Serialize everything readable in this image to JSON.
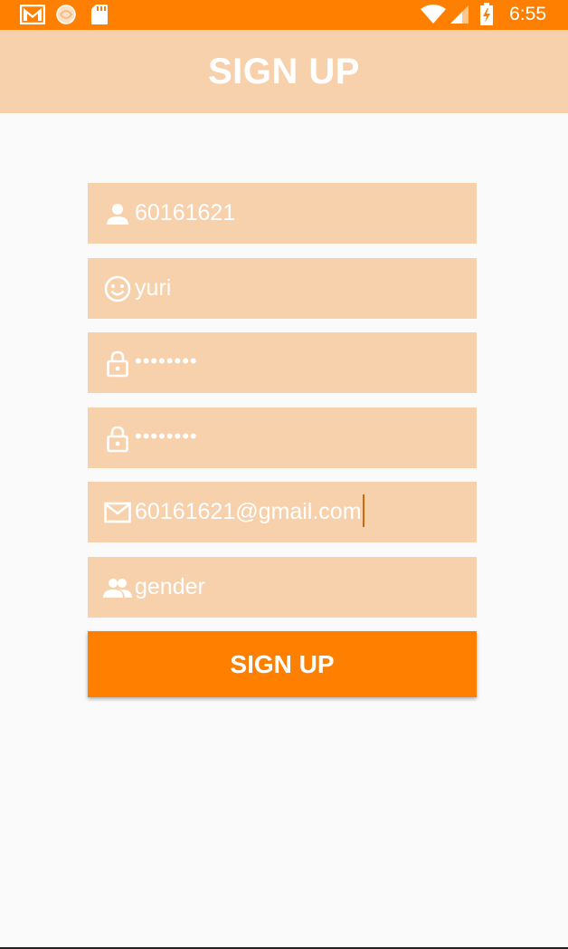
{
  "status_bar": {
    "time": "6:55",
    "icons": [
      "gmail-icon",
      "app-notification-icon",
      "sd-card-icon",
      "wifi-icon",
      "cell-signal-icon",
      "battery-charging-icon"
    ]
  },
  "app_bar": {
    "title": "SIGN UP"
  },
  "form": {
    "username": {
      "value": "60161621",
      "icon": "person-icon"
    },
    "nickname": {
      "value": "yuri",
      "icon": "smiley-icon"
    },
    "password": {
      "value": "••••••••",
      "icon": "lock-icon"
    },
    "confirm_password": {
      "value": "••••••••",
      "icon": "lock-icon"
    },
    "email": {
      "value": "60161621@gmail.com",
      "icon": "mail-icon"
    },
    "gender": {
      "placeholder": "gender",
      "icon": "people-icon"
    },
    "submit_label": "SIGN UP"
  },
  "colors": {
    "primary": "#ff8000",
    "field_bg": "#f7d1ab",
    "background": "#fafafa",
    "text_on_primary": "#ffffff"
  }
}
